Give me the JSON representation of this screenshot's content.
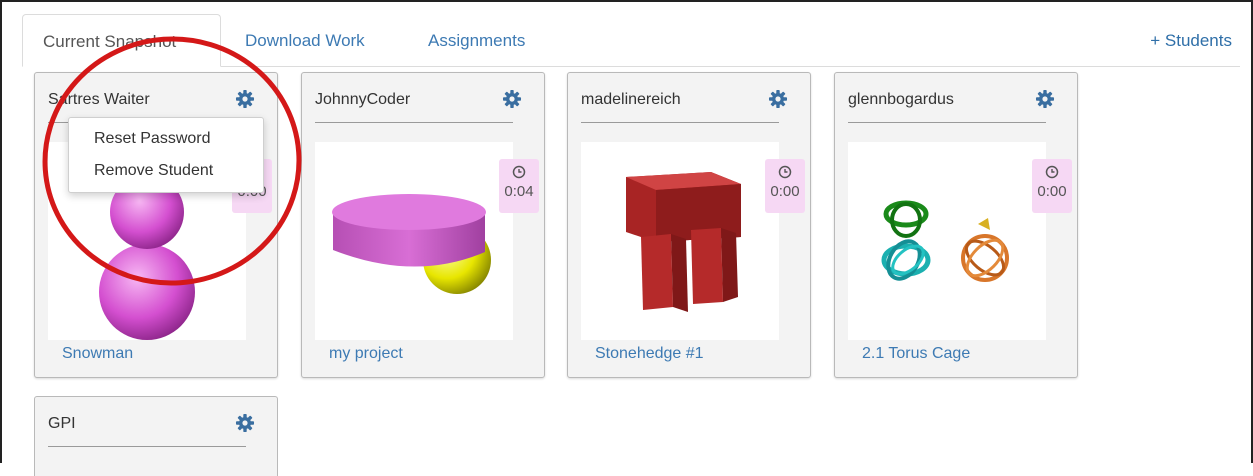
{
  "tabs": {
    "current_snapshot": "Current Snapshot",
    "download_work": "Download Work",
    "assignments": "Assignments",
    "add_students": "+ Students"
  },
  "cards": [
    {
      "name": "Sartres Waiter",
      "time": "0:00",
      "project": "Snowman"
    },
    {
      "name": "JohnnyCoder",
      "time": "0:04",
      "project": "my project"
    },
    {
      "name": "madelinereich",
      "time": "0:00",
      "project": "Stonehedge #1"
    },
    {
      "name": "glennbogardus",
      "time": "0:00",
      "project": "2.1 Torus Cage"
    },
    {
      "name": "GPI"
    }
  ],
  "menu": {
    "reset_password": "Reset Password",
    "remove_student": "Remove Student"
  },
  "colors": {
    "link": "#3d7ab3",
    "timer_bg": "#f6d8f4",
    "annotation_circle": "#d41818",
    "gear": "#3a6ea0"
  },
  "icons": {
    "settings": "gear-icon",
    "timer": "clock-icon"
  }
}
